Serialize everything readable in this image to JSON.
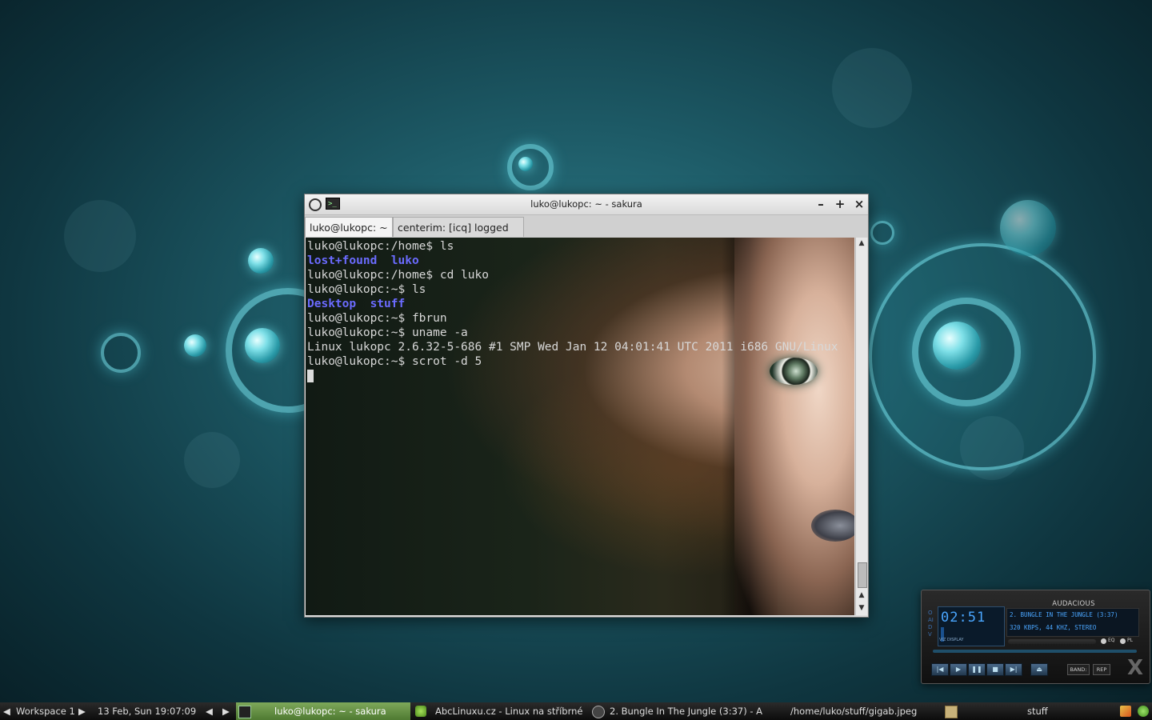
{
  "window": {
    "title": "luko@lukopc: ~ - sakura",
    "minimize": "–",
    "maximize": "+",
    "close": "×",
    "tabs": [
      {
        "label": "luko@lukopc: ~"
      },
      {
        "label": "centerim: [icq] logged in"
      }
    ],
    "terminal": {
      "l1": "luko@lukopc:/home$ ls",
      "l2a": "lost+found",
      "l2b": "luko",
      "l3": "luko@lukopc:/home$ cd luko",
      "l4": "luko@lukopc:~$ ls",
      "l5a": "Desktop",
      "l5b": "stuff",
      "l6": "luko@lukopc:~$ fbrun",
      "l7": "luko@lukopc:~$ uname -a",
      "l8": "Linux lukopc 2.6.32-5-686 #1 SMP Wed Jan 12 04:01:41 UTC 2011 i686 GNU/Linux",
      "l9": "luko@lukopc:~$ scrot -d 5"
    }
  },
  "audacious": {
    "name": "AUDACIOUS",
    "time": "02:51",
    "track": "2. BUNGLE IN THE JUNGLE (3:37)",
    "rate": "320 KBPS, 44 KHZ, STEREO",
    "side_label": "OAIDV",
    "viz_label": "VIZ DISPLAY",
    "eq": "EQ",
    "pl": "PL",
    "band": "BAND:",
    "rep": "REP",
    "logo": "X",
    "controls": [
      "|◀",
      "▶",
      "❚❚",
      "■",
      "▶|"
    ],
    "eject": "⏏"
  },
  "taskbar": {
    "workspace": "Workspace 1",
    "clock": "13 Feb, Sun 19:07:09",
    "prev": "◀",
    "next": "▶",
    "items": [
      {
        "label": "luko@lukopc: ~ - sakura"
      },
      {
        "label": "AbcLinuxu.cz - Linux na stříbrné"
      },
      {
        "label": "2. Bungle In The Jungle (3:37) - A"
      },
      {
        "label": "/home/luko/stuff/gigab.jpeg"
      },
      {
        "label": "stuff"
      }
    ]
  },
  "colors": {
    "dir": "#6b6bff",
    "taskbar_active": "#6a9446",
    "lcd_text": "#4aa6ff"
  }
}
